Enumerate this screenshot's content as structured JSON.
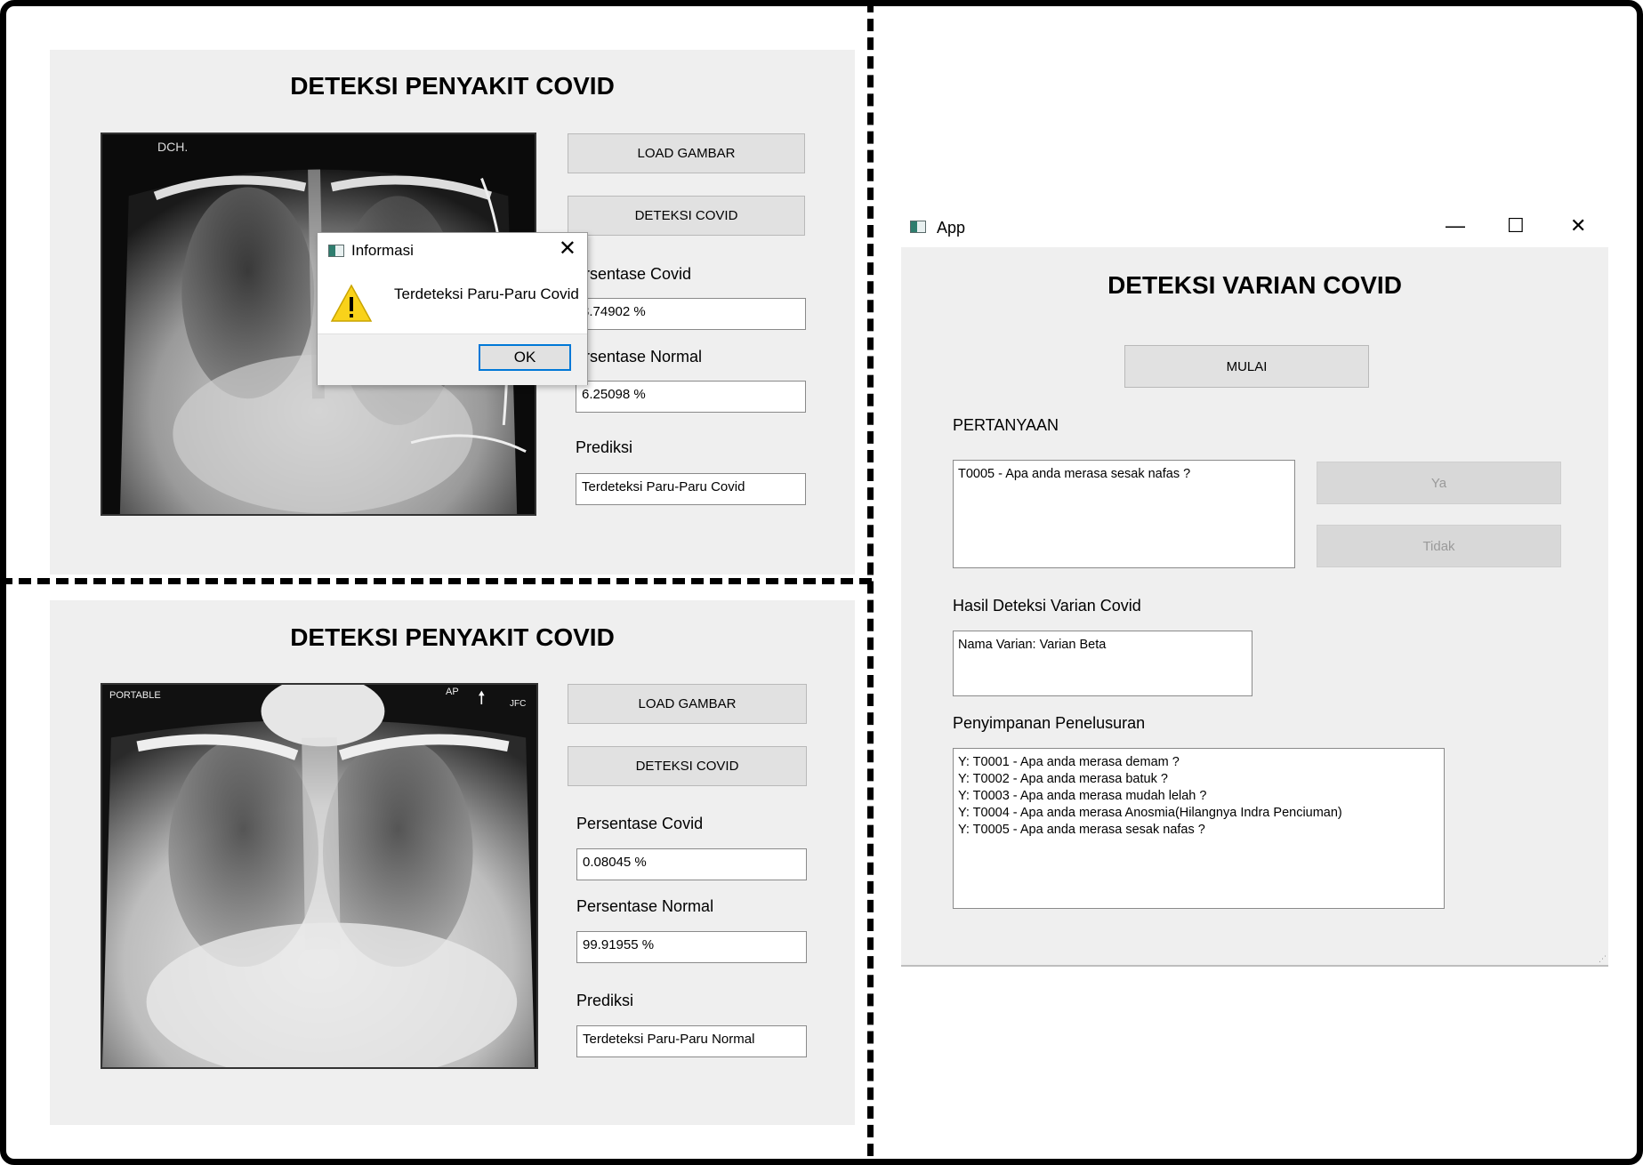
{
  "panel1": {
    "title": "DETEKSI PENYAKIT COVID",
    "xray_marker": "DCH.",
    "load_button": "LOAD GAMBAR",
    "detect_button": "DETEKSI COVID",
    "covid_label": "ersentase Covid",
    "covid_value": "3.74902 %",
    "normal_label": "ersentase Normal",
    "normal_value": "6.25098 %",
    "prediction_label": "Prediksi",
    "prediction_value": "Terdeteksi Paru-Paru Covid"
  },
  "dialog": {
    "title": "Informasi",
    "close_glyph": "✕",
    "icon": "warning-icon",
    "message": "Terdeteksi Paru-Paru Covid",
    "ok_button": "OK"
  },
  "panel2": {
    "title": "DETEKSI PENYAKIT COVID",
    "xray_marker_left": "PORTABLE",
    "xray_marker_ap": "AP",
    "xray_marker_right": "JFC",
    "load_button": "LOAD GAMBAR",
    "detect_button": "DETEKSI COVID",
    "covid_label": "Persentase Covid",
    "covid_value": "0.08045 %",
    "normal_label": "Persentase Normal",
    "normal_value": "99.91955 %",
    "prediction_label": "Prediksi",
    "prediction_value": "Terdeteksi Paru-Paru Normal"
  },
  "app_window": {
    "window_title": "App",
    "minimize_glyph": "—",
    "maximize_glyph": "☐",
    "close_glyph": "✕",
    "heading": "DETEKSI VARIAN COVID",
    "start_button": "MULAI",
    "question_label": "PERTANYAAN",
    "question_text": "T0005 - Apa anda merasa sesak nafas ?",
    "yes_button": "Ya",
    "no_button": "Tidak",
    "result_label": "Hasil Deteksi Varian Covid",
    "result_text": "Nama Varian: Varian Beta",
    "history_label": "Penyimpanan Penelusuran",
    "history_items": [
      "Y: T0001 - Apa anda merasa demam ?",
      "Y: T0002 - Apa anda merasa batuk ?",
      "Y: T0003 - Apa anda merasa mudah lelah ?",
      "Y: T0004 - Apa anda merasa Anosmia(Hilangnya Indra Penciuman)",
      "Y: T0005 - Apa anda merasa sesak nafas ?"
    ]
  }
}
